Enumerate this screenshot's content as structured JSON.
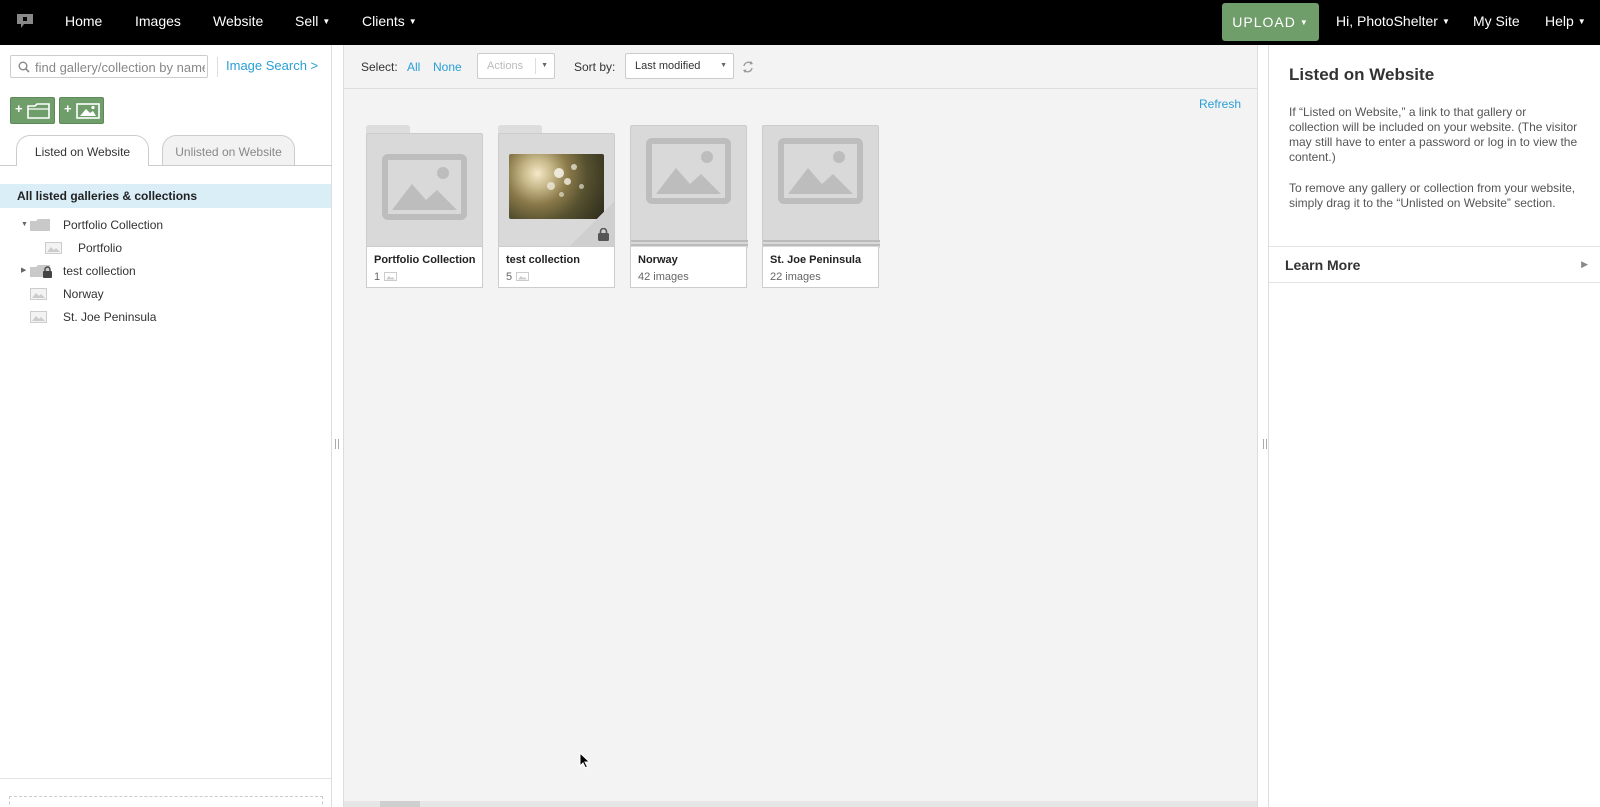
{
  "nav": {
    "home": "Home",
    "images": "Images",
    "website": "Website",
    "sell": "Sell",
    "clients": "Clients",
    "upload": "UPLOAD",
    "greeting": "Hi, PhotoShelter",
    "my_site": "My Site",
    "help": "Help"
  },
  "left": {
    "search_placeholder": "find gallery/collection by name",
    "image_search": "Image Search >",
    "tabs": [
      "Listed on Website",
      "Unlisted on Website"
    ],
    "tree_header": "All listed galleries & collections",
    "tree": [
      {
        "label": "Portfolio Collection",
        "type": "collection",
        "expanded": true
      },
      {
        "label": "Portfolio",
        "type": "gallery",
        "child": true
      },
      {
        "label": "test collection",
        "type": "collection-locked",
        "expanded": false
      },
      {
        "label": "Norway",
        "type": "gallery"
      },
      {
        "label": "St. Joe Peninsula",
        "type": "gallery"
      }
    ]
  },
  "toolbar": {
    "select_label": "Select:",
    "all": "All",
    "none": "None",
    "actions": "Actions",
    "sort_label": "Sort by:",
    "sort_value": "Last modified"
  },
  "main": {
    "refresh": "Refresh",
    "cards": [
      {
        "name": "Portfolio Collection",
        "count": "1",
        "kind": "collection"
      },
      {
        "name": "test collection",
        "count": "5",
        "kind": "collection-locked"
      },
      {
        "name": "Norway",
        "count": "42 images",
        "kind": "gallery"
      },
      {
        "name": "St. Joe Peninsula",
        "count": "22 images",
        "kind": "gallery"
      }
    ]
  },
  "right": {
    "title": "Listed on Website",
    "para1": "If “Listed on Website,” a link to that gallery or collection will be included on your website. (The visitor may still have to enter a password or log in to view the content.)",
    "para2": "To remove any gallery or collection from your website, simply drag it to the “Unlisted on Website” section.",
    "learn_more": "Learn More"
  },
  "colors": {
    "accent_blue": "#2a9fd6",
    "upload_green": "#6f9e6b",
    "topbar": "#000000",
    "selected_row": "#daeef8"
  }
}
